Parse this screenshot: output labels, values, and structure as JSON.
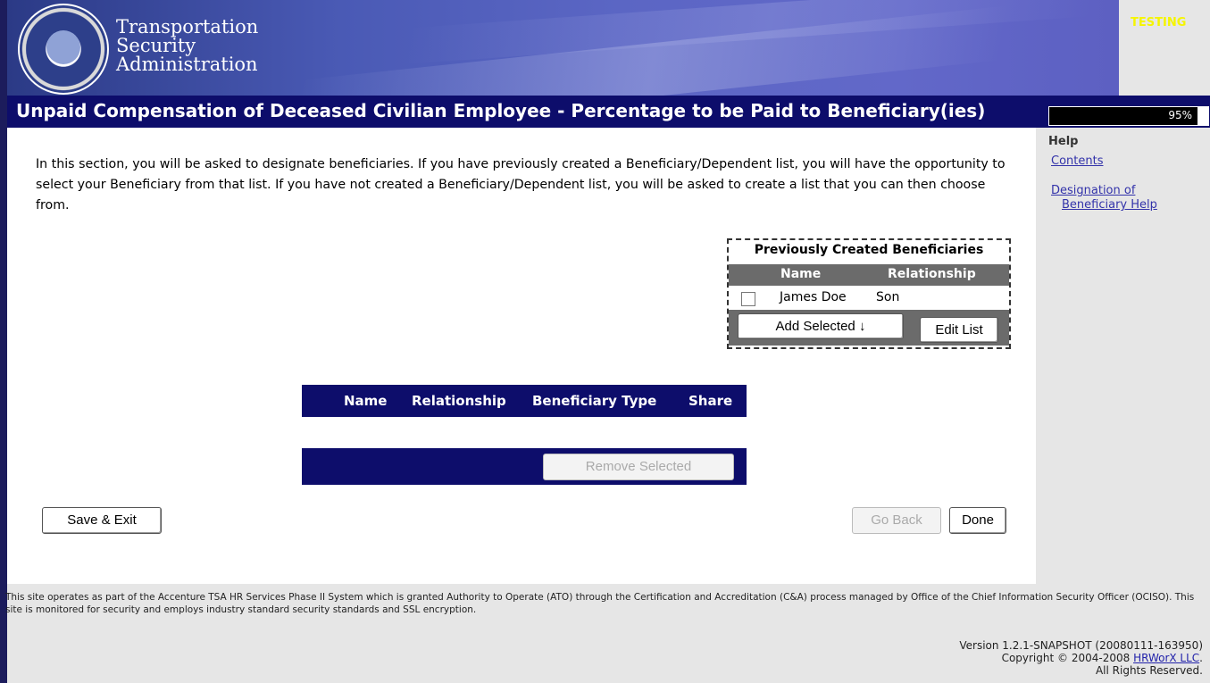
{
  "header": {
    "agency_lines": [
      "Transportation",
      "Security",
      "Administration"
    ],
    "environment_badge": "TESTING",
    "seal_icon": "dhs-seal-icon"
  },
  "titlebar": {
    "title": "Unpaid Compensation of Deceased Civilian Employee - Percentage to be Paid to Beneficiary(ies)",
    "progress_label": "95%",
    "progress_value": 0.95
  },
  "intro": {
    "text": "In this section, you will be asked to designate beneficiaries. If you have previously created a Beneficiary/Dependent list, you will have the opportunity to select your Beneficiary from that list. If you have not created a Beneficiary/Dependent list, you will be asked to create a list that you can then choose from."
  },
  "help": {
    "heading": "Help",
    "contents_link": "Contents",
    "designation_link_line1": "Designation of",
    "designation_link_line2": "Beneficiary Help"
  },
  "previous_beneficiaries": {
    "caption": "Previously Created Beneficiaries",
    "columns": [
      "Name",
      "Relationship"
    ],
    "rows": [
      {
        "name": "James Doe",
        "relationship": "Son",
        "checked": false
      }
    ],
    "add_button": "Add Selected ↓",
    "edit_button": "Edit List"
  },
  "beneficiary_table": {
    "columns": [
      "Name",
      "Relationship",
      "Beneficiary Type",
      "Share"
    ],
    "rows": [],
    "remove_button": "Remove Selected"
  },
  "actions": {
    "save_exit": "Save & Exit",
    "go_back": "Go Back",
    "done": "Done"
  },
  "footer": {
    "notice": "This site operates as part of the Accenture TSA HR Services Phase II System which is granted Authority to Operate (ATO) through the Certification and Accreditation (C&A) process managed by Office of the Chief Information Security Officer (OCISO). This site is monitored for security and employs industry standard security standards and SSL encryption.",
    "version": "Version 1.2.1-SNAPSHOT (20080111-163950)",
    "copyright_prefix": "Copyright © 2004-2008 ",
    "company_link": "HRWorX LLC",
    "copyright_suffix": ".",
    "rights": "All Rights Reserved."
  },
  "colors": {
    "title_bar": "#0d0d6b",
    "testing_badge": "#f5f500",
    "link": "#3333aa"
  }
}
